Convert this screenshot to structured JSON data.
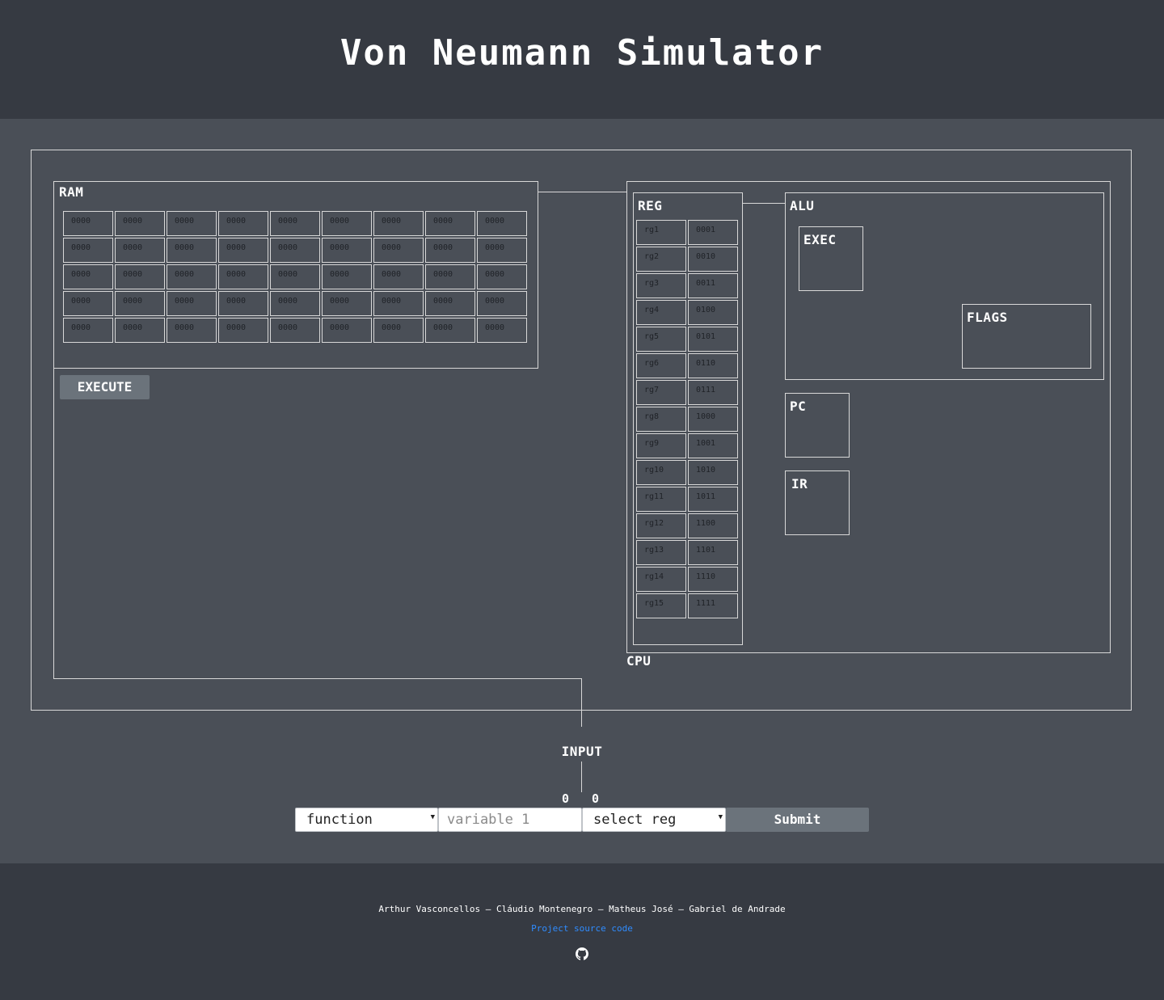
{
  "header": {
    "title": "Von Neumann Simulator"
  },
  "ram": {
    "label": "RAM",
    "rows": [
      [
        "0000",
        "0000",
        "0000",
        "0000",
        "0000",
        "0000",
        "0000",
        "0000",
        "0000"
      ],
      [
        "0000",
        "0000",
        "0000",
        "0000",
        "0000",
        "0000",
        "0000",
        "0000",
        "0000"
      ],
      [
        "0000",
        "0000",
        "0000",
        "0000",
        "0000",
        "0000",
        "0000",
        "0000",
        "0000"
      ],
      [
        "0000",
        "0000",
        "0000",
        "0000",
        "0000",
        "0000",
        "0000",
        "0000",
        "0000"
      ],
      [
        "0000",
        "0000",
        "0000",
        "0000",
        "0000",
        "0000",
        "0000",
        "0000",
        "0000"
      ]
    ],
    "execute_label": "EXECUTE"
  },
  "cpu": {
    "label": "CPU",
    "reg": {
      "label": "REG",
      "registers": [
        {
          "name": "rg1",
          "value": "0001"
        },
        {
          "name": "rg2",
          "value": "0010"
        },
        {
          "name": "rg3",
          "value": "0011"
        },
        {
          "name": "rg4",
          "value": "0100"
        },
        {
          "name": "rg5",
          "value": "0101"
        },
        {
          "name": "rg6",
          "value": "0110"
        },
        {
          "name": "rg7",
          "value": "0111"
        },
        {
          "name": "rg8",
          "value": "1000"
        },
        {
          "name": "rg9",
          "value": "1001"
        },
        {
          "name": "rg10",
          "value": "1010"
        },
        {
          "name": "rg11",
          "value": "1011"
        },
        {
          "name": "rg12",
          "value": "1100"
        },
        {
          "name": "rg13",
          "value": "1101"
        },
        {
          "name": "rg14",
          "value": "1110"
        },
        {
          "name": "rg15",
          "value": "1111"
        }
      ]
    },
    "alu": {
      "label": "ALU",
      "exec_label": "EXEC",
      "flags_label": "FLAGS"
    },
    "pc_label": "PC",
    "ir_label": "IR"
  },
  "input": {
    "label": "INPUT",
    "counters": [
      "0",
      "0"
    ],
    "function_select": "function",
    "variable_placeholder": "variable 1",
    "reg_select": "select reg",
    "submit_label": "Submit"
  },
  "footer": {
    "credits": "Arthur Vasconcellos — Cláudio Montenegro — Matheus José — Gabriel de Andrade",
    "source_link": "Project source code",
    "github_icon": "github-icon"
  },
  "colors": {
    "background": "#4a4f57",
    "header_footer": "#363a42",
    "button": "#6b737b",
    "link": "#2f8cff",
    "border": "#d8d8d8"
  }
}
